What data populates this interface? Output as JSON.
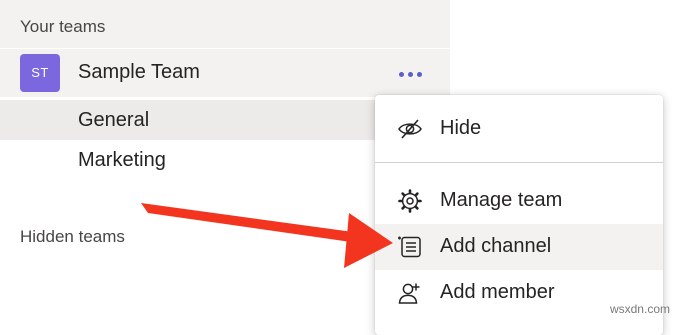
{
  "sidebar": {
    "your_teams_header": "Your teams",
    "team": {
      "initials": "ST",
      "name": "Sample Team",
      "avatar_color": "#7b68de"
    },
    "channels": [
      {
        "label": "General",
        "selected": true
      },
      {
        "label": "Marketing",
        "selected": false
      }
    ],
    "hidden_teams_header": "Hidden teams"
  },
  "context_menu": {
    "items": [
      {
        "label": "Hide",
        "icon": "eye-off-icon"
      },
      {
        "label": "Manage team",
        "icon": "gear-icon"
      },
      {
        "label": "Add channel",
        "icon": "channel-list-icon",
        "highlighted": true
      },
      {
        "label": "Add member",
        "icon": "add-person-icon"
      }
    ]
  },
  "annotation": {
    "arrow_color": "#f3351f"
  },
  "watermark": "wsxdn.com"
}
